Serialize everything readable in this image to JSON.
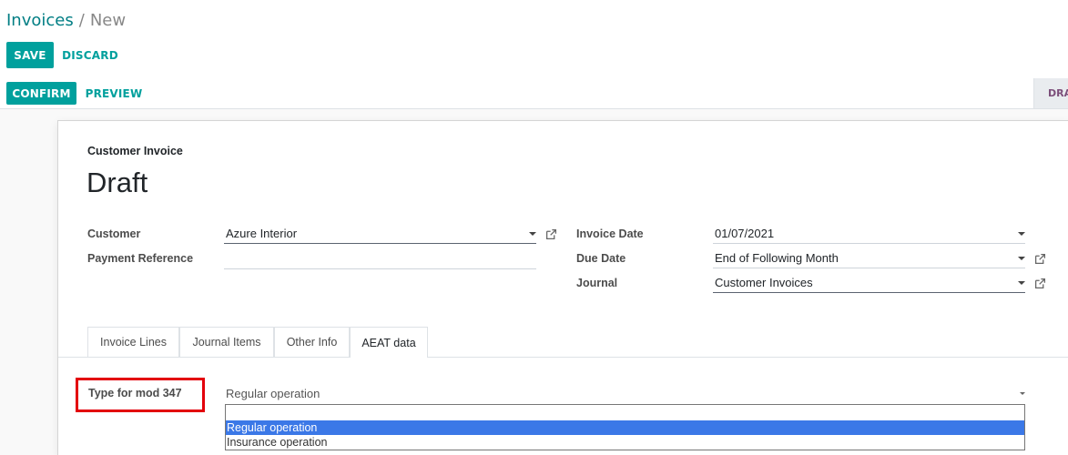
{
  "breadcrumb": {
    "parent": "Invoices",
    "separator": "/",
    "current": "New"
  },
  "control_panel": {
    "save_label": "SAVE",
    "discard_label": "DISCARD"
  },
  "statusbar": {
    "confirm_label": "CONFIRM",
    "preview_label": "PREVIEW",
    "stage_label": "DRAFT"
  },
  "sheet": {
    "subtitle": "Customer Invoice",
    "name": "Draft",
    "left_fields": [
      {
        "label": "Customer",
        "value": "Azure Interior"
      },
      {
        "label": "Payment Reference",
        "value": ""
      }
    ],
    "right_fields": [
      {
        "label": "Invoice Date",
        "value": "01/07/2021"
      },
      {
        "label": "Due Date",
        "value": "End of Following Month"
      },
      {
        "label": "Journal",
        "value": "Customer Invoices"
      }
    ],
    "tabs": [
      "Invoice Lines",
      "Journal Items",
      "Other Info",
      "AEAT data"
    ],
    "active_tab": "AEAT data",
    "aeat": {
      "label": "Type for mod 347",
      "selected": "Regular operation",
      "options": [
        "",
        "Regular operation",
        "Insurance operation"
      ]
    }
  },
  "colors": {
    "primary": "#00a09d",
    "highlight_box": "#e3000b",
    "selected_option": "#3b78e7"
  }
}
